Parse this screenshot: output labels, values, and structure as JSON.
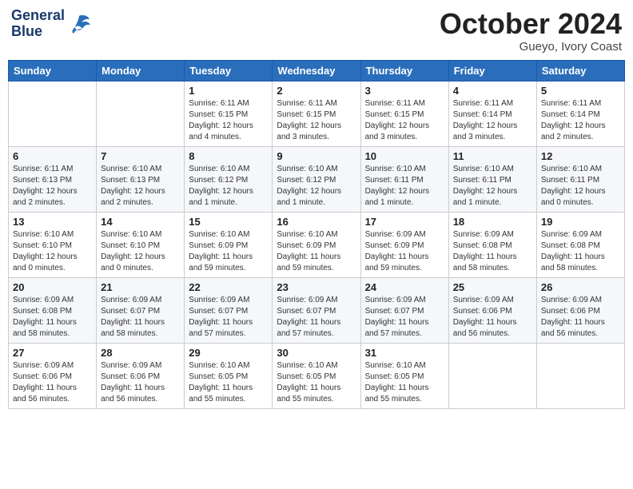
{
  "header": {
    "logo_line1": "General",
    "logo_line2": "Blue",
    "month": "October 2024",
    "location": "Gueyo, Ivory Coast"
  },
  "weekdays": [
    "Sunday",
    "Monday",
    "Tuesday",
    "Wednesday",
    "Thursday",
    "Friday",
    "Saturday"
  ],
  "weeks": [
    [
      {
        "day": "",
        "info": ""
      },
      {
        "day": "",
        "info": ""
      },
      {
        "day": "1",
        "info": "Sunrise: 6:11 AM\nSunset: 6:15 PM\nDaylight: 12 hours and 4 minutes."
      },
      {
        "day": "2",
        "info": "Sunrise: 6:11 AM\nSunset: 6:15 PM\nDaylight: 12 hours and 3 minutes."
      },
      {
        "day": "3",
        "info": "Sunrise: 6:11 AM\nSunset: 6:15 PM\nDaylight: 12 hours and 3 minutes."
      },
      {
        "day": "4",
        "info": "Sunrise: 6:11 AM\nSunset: 6:14 PM\nDaylight: 12 hours and 3 minutes."
      },
      {
        "day": "5",
        "info": "Sunrise: 6:11 AM\nSunset: 6:14 PM\nDaylight: 12 hours and 2 minutes."
      }
    ],
    [
      {
        "day": "6",
        "info": "Sunrise: 6:11 AM\nSunset: 6:13 PM\nDaylight: 12 hours and 2 minutes."
      },
      {
        "day": "7",
        "info": "Sunrise: 6:10 AM\nSunset: 6:13 PM\nDaylight: 12 hours and 2 minutes."
      },
      {
        "day": "8",
        "info": "Sunrise: 6:10 AM\nSunset: 6:12 PM\nDaylight: 12 hours and 1 minute."
      },
      {
        "day": "9",
        "info": "Sunrise: 6:10 AM\nSunset: 6:12 PM\nDaylight: 12 hours and 1 minute."
      },
      {
        "day": "10",
        "info": "Sunrise: 6:10 AM\nSunset: 6:11 PM\nDaylight: 12 hours and 1 minute."
      },
      {
        "day": "11",
        "info": "Sunrise: 6:10 AM\nSunset: 6:11 PM\nDaylight: 12 hours and 1 minute."
      },
      {
        "day": "12",
        "info": "Sunrise: 6:10 AM\nSunset: 6:11 PM\nDaylight: 12 hours and 0 minutes."
      }
    ],
    [
      {
        "day": "13",
        "info": "Sunrise: 6:10 AM\nSunset: 6:10 PM\nDaylight: 12 hours and 0 minutes."
      },
      {
        "day": "14",
        "info": "Sunrise: 6:10 AM\nSunset: 6:10 PM\nDaylight: 12 hours and 0 minutes."
      },
      {
        "day": "15",
        "info": "Sunrise: 6:10 AM\nSunset: 6:09 PM\nDaylight: 11 hours and 59 minutes."
      },
      {
        "day": "16",
        "info": "Sunrise: 6:10 AM\nSunset: 6:09 PM\nDaylight: 11 hours and 59 minutes."
      },
      {
        "day": "17",
        "info": "Sunrise: 6:09 AM\nSunset: 6:09 PM\nDaylight: 11 hours and 59 minutes."
      },
      {
        "day": "18",
        "info": "Sunrise: 6:09 AM\nSunset: 6:08 PM\nDaylight: 11 hours and 58 minutes."
      },
      {
        "day": "19",
        "info": "Sunrise: 6:09 AM\nSunset: 6:08 PM\nDaylight: 11 hours and 58 minutes."
      }
    ],
    [
      {
        "day": "20",
        "info": "Sunrise: 6:09 AM\nSunset: 6:08 PM\nDaylight: 11 hours and 58 minutes."
      },
      {
        "day": "21",
        "info": "Sunrise: 6:09 AM\nSunset: 6:07 PM\nDaylight: 11 hours and 58 minutes."
      },
      {
        "day": "22",
        "info": "Sunrise: 6:09 AM\nSunset: 6:07 PM\nDaylight: 11 hours and 57 minutes."
      },
      {
        "day": "23",
        "info": "Sunrise: 6:09 AM\nSunset: 6:07 PM\nDaylight: 11 hours and 57 minutes."
      },
      {
        "day": "24",
        "info": "Sunrise: 6:09 AM\nSunset: 6:07 PM\nDaylight: 11 hours and 57 minutes."
      },
      {
        "day": "25",
        "info": "Sunrise: 6:09 AM\nSunset: 6:06 PM\nDaylight: 11 hours and 56 minutes."
      },
      {
        "day": "26",
        "info": "Sunrise: 6:09 AM\nSunset: 6:06 PM\nDaylight: 11 hours and 56 minutes."
      }
    ],
    [
      {
        "day": "27",
        "info": "Sunrise: 6:09 AM\nSunset: 6:06 PM\nDaylight: 11 hours and 56 minutes."
      },
      {
        "day": "28",
        "info": "Sunrise: 6:09 AM\nSunset: 6:06 PM\nDaylight: 11 hours and 56 minutes."
      },
      {
        "day": "29",
        "info": "Sunrise: 6:10 AM\nSunset: 6:05 PM\nDaylight: 11 hours and 55 minutes."
      },
      {
        "day": "30",
        "info": "Sunrise: 6:10 AM\nSunset: 6:05 PM\nDaylight: 11 hours and 55 minutes."
      },
      {
        "day": "31",
        "info": "Sunrise: 6:10 AM\nSunset: 6:05 PM\nDaylight: 11 hours and 55 minutes."
      },
      {
        "day": "",
        "info": ""
      },
      {
        "day": "",
        "info": ""
      }
    ]
  ]
}
